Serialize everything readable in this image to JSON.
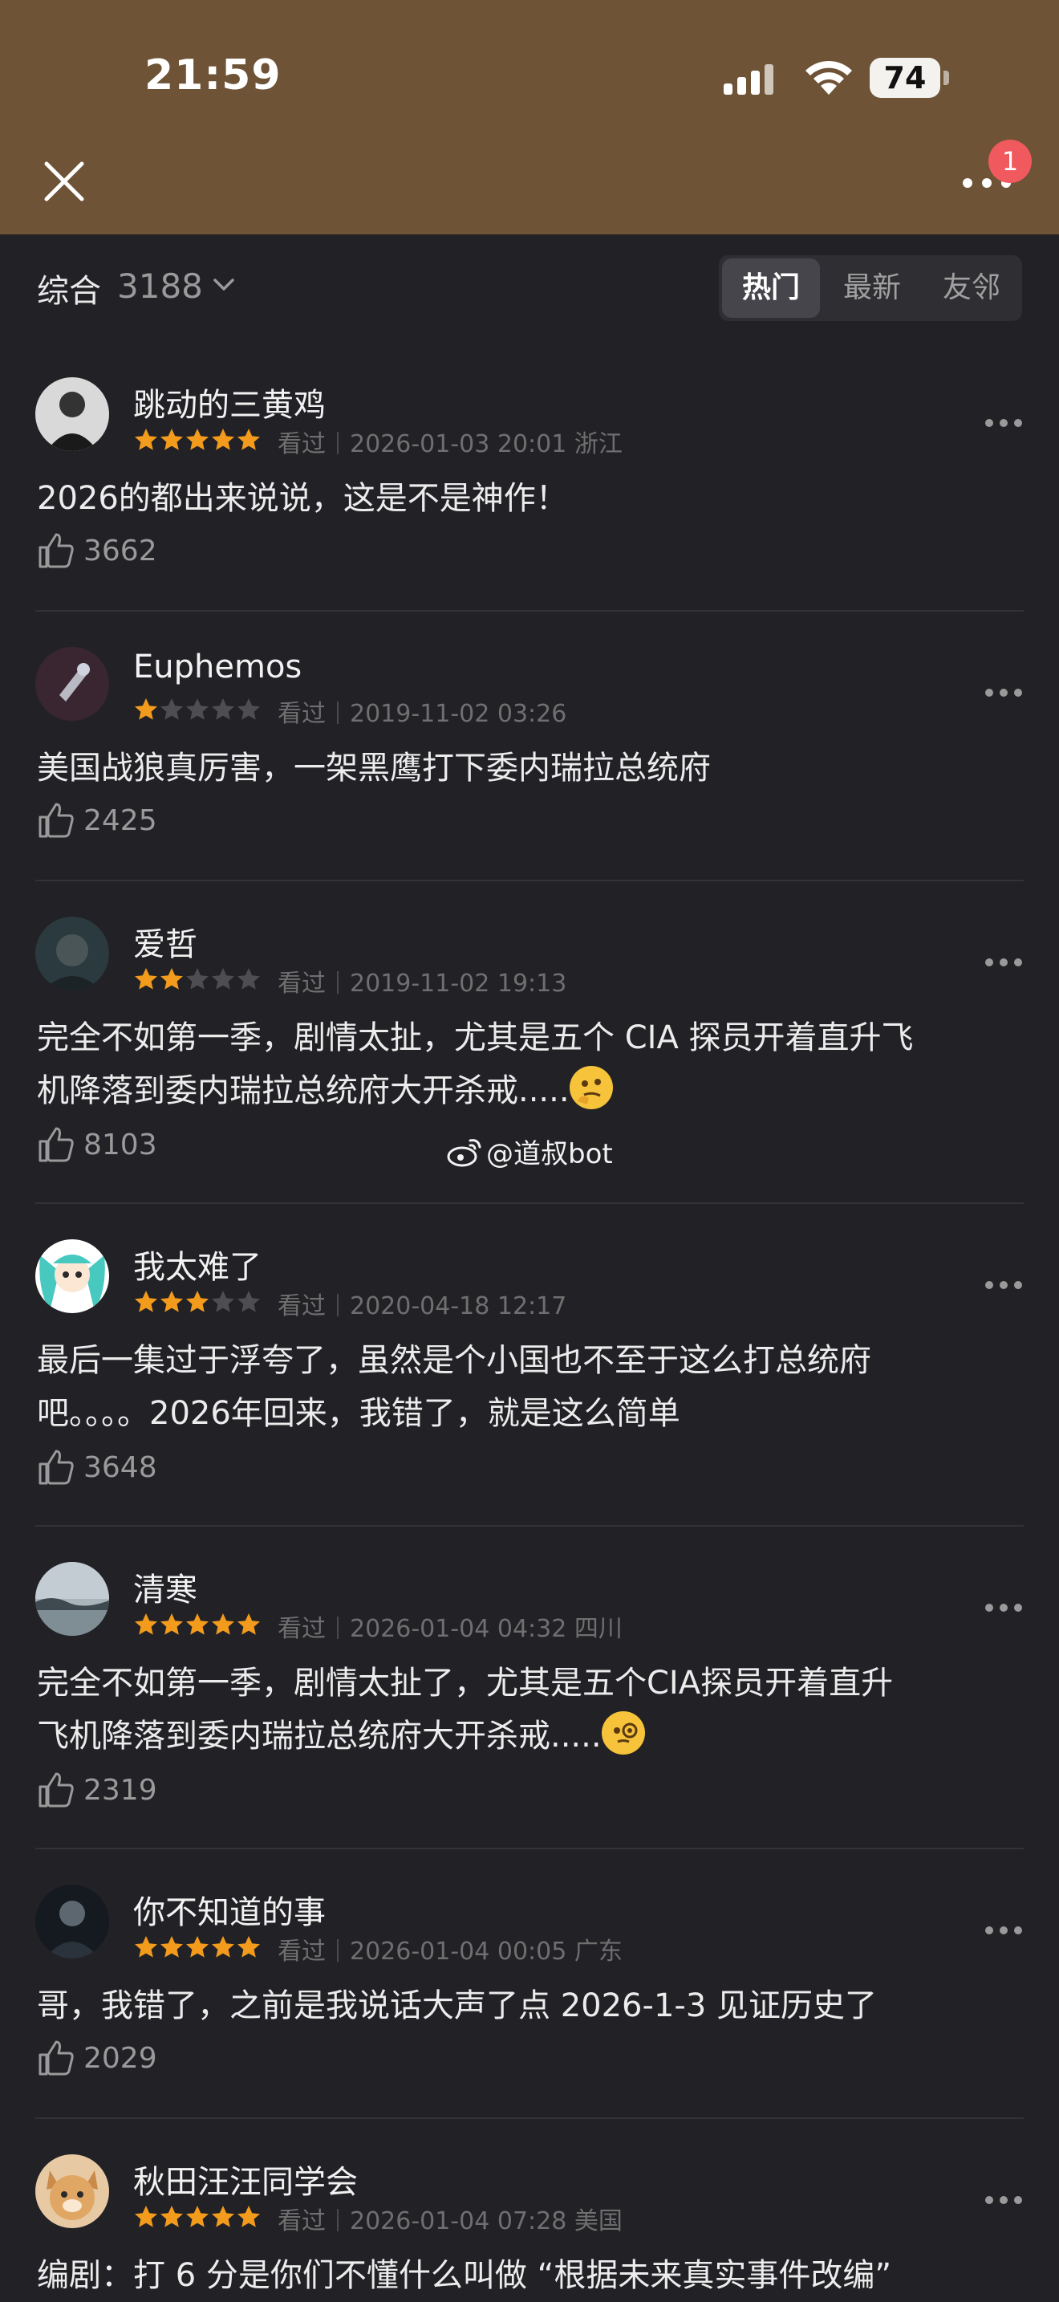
{
  "status": {
    "time": "21:59",
    "battery": "74"
  },
  "header": {
    "notification_count": "1"
  },
  "filter": {
    "label": "综合",
    "count": "3188",
    "tabs": [
      "热门",
      "最新",
      "友邻"
    ],
    "active_tab": "热门"
  },
  "watermark": "@道叔bot",
  "comments": [
    {
      "username": "跳动的三黄鸡",
      "rating": 5,
      "watched": "看过",
      "date": "2026-01-03 20:01",
      "location": "浙江",
      "text": "2026的都出来说说，这是不是神作！",
      "likes": "3662"
    },
    {
      "username": "Euphemos",
      "rating": 1,
      "watched": "看过",
      "date": "2019-11-02 03:26",
      "location": "",
      "text": "美国战狼真厉害，一架黑鹰打下委内瑞拉总统府",
      "likes": "2425"
    },
    {
      "username": "爱哲",
      "rating": 2,
      "watched": "看过",
      "date": "2019-11-02 19:13",
      "location": "",
      "text_line1": "完全不如第一季，剧情太扯，尤其是五个 CIA 探员开着直升飞",
      "text_line2": "机降落到委内瑞拉总统府大开杀戒.....",
      "emoji": "thinking-face",
      "likes": "8103"
    },
    {
      "username": "我太难了",
      "rating": 3,
      "watched": "看过",
      "date": "2020-04-18 12:17",
      "location": "",
      "text_line1": "最后一集过于浮夸了，虽然是个小国也不至于这么打总统府",
      "text_line2": "吧。。。。2026年回来，我错了，就是这么简单",
      "likes": "3648"
    },
    {
      "username": "清寒",
      "rating": 5,
      "watched": "看过",
      "date": "2026-01-04 04:32",
      "location": "四川",
      "text_line1": "完全不如第一季，剧情太扯了，尤其是五个CIA探员开着直升",
      "text_line2": "飞机降落到委内瑞拉总统府大开杀戒.....",
      "emoji": "monocle-face",
      "likes": "2319"
    },
    {
      "username": "你不知道的事",
      "rating": 5,
      "watched": "看过",
      "date": "2026-01-04 00:05",
      "location": "广东",
      "text": "哥，我错了，之前是我说话大声了点 2026-1-3 见证历史了",
      "likes": "2029"
    },
    {
      "username": "秋田汪汪同学会",
      "rating": 5,
      "watched": "看过",
      "date": "2026-01-04 07:28",
      "location": "美国",
      "text": "编剧：打 6 分是你们不懂什么叫做 “根据未来真实事件改编”",
      "likes": ""
    }
  ],
  "colors": {
    "star_on": "#f39b1c",
    "star_off": "#4d4d52",
    "header_bg": "#6e5336",
    "page_bg": "#222226"
  }
}
